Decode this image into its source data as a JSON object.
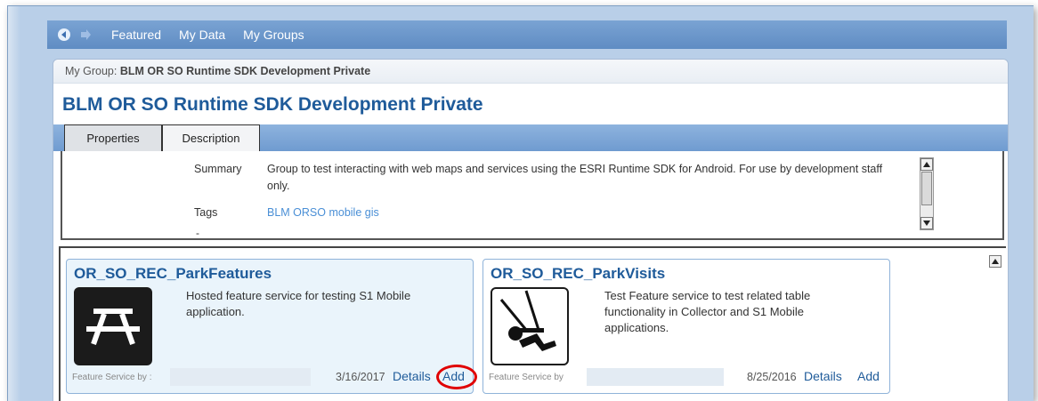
{
  "nav": {
    "items": [
      "Featured",
      "My Data",
      "My Groups"
    ],
    "back_icon": "back-arrow-icon",
    "forward_icon": "forward-arrow-icon"
  },
  "breadcrumb": {
    "prefix": "My Group:",
    "group": "BLM OR SO Runtime SDK Development Private"
  },
  "page_title": "BLM OR SO Runtime SDK Development Private",
  "tabs": [
    {
      "label": "Properties",
      "active": true
    },
    {
      "label": "Description",
      "active": false
    }
  ],
  "properties": {
    "summary_label": "Summary",
    "summary_value": "Group to test interacting with web maps and services using the ESRI Runtime SDK for Android. For use by development staff only.",
    "tags_label": "Tags",
    "tags_value": "BLM ORSO mobile gis",
    "dash": "-"
  },
  "cards": [
    {
      "title": "OR_SO_REC_ParkFeatures",
      "description": "Hosted feature service for testing S1 Mobile application.",
      "footer_label": "Feature Service by :",
      "date": "3/16/2017",
      "details_label": "Details",
      "add_label": "Add",
      "thumbnail_icon": "picnic-table-icon",
      "add_highlighted": true
    },
    {
      "title": "OR_SO_REC_ParkVisits",
      "description": "Test Feature service to test related table functionality in Collector and S1 Mobile applications.",
      "footer_label": "Feature Service by",
      "date": "8/25/2016",
      "details_label": "Details",
      "add_label": "Add",
      "thumbnail_icon": "swing-icon",
      "add_highlighted": false
    }
  ],
  "colors": {
    "accent": "#1f5b9a",
    "nav_bar": "#6f9bd0",
    "tag_link": "#4a8fd6",
    "highlight": "#e00000"
  }
}
